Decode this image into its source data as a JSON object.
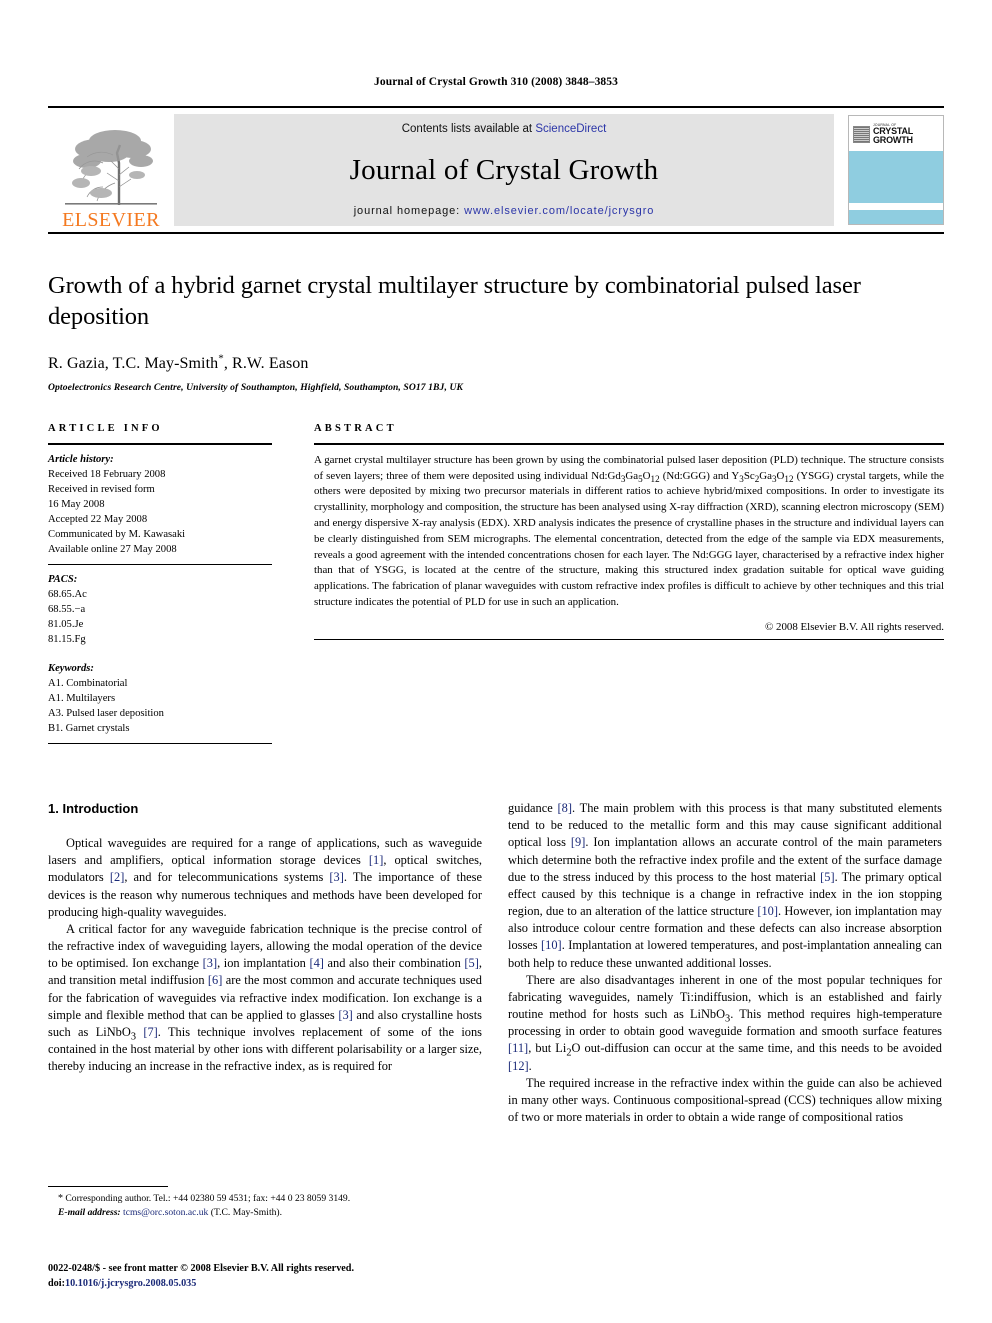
{
  "running_head": "Journal of Crystal Growth 310 (2008) 3848–3853",
  "masthead": {
    "publisher_name": "ELSEVIER",
    "contents_prefix": "Contents lists available at ",
    "contents_link": "ScienceDirect",
    "journal_title": "Journal of Crystal Growth",
    "homepage_prefix": "journal homepage: ",
    "homepage_url": "www.elsevier.com/locate/jcrysgro",
    "cover": {
      "pre_label": "JOURNAL OF",
      "line1": "CRYSTAL",
      "line2": "GROWTH",
      "accent_color": "#8fcde0"
    },
    "banner_bg": "#e3e3e3",
    "link_color": "#2b35a8",
    "elsevier_orange": "#F47920"
  },
  "article": {
    "title": "Growth of a hybrid garnet crystal multilayer structure by combinatorial pulsed laser deposition",
    "authors_before": "R. Gazia, T.C. May-Smith",
    "authors_star": "*",
    "authors_after": ", R.W. Eason",
    "affiliation": "Optoelectronics Research Centre, University of Southampton, Highfield, Southampton, SO17 1BJ, UK"
  },
  "article_info": {
    "heading": "ARTICLE INFO",
    "history_label": "Article history:",
    "history": [
      "Received 18 February 2008",
      "Received in revised form",
      "16 May 2008",
      "Accepted 22 May 2008",
      "Communicated by M. Kawasaki",
      "Available online 27 May 2008"
    ],
    "pacs_label": "PACS:",
    "pacs": [
      "68.65.Ac",
      "68.55.−a",
      "81.05.Je",
      "81.15.Fg"
    ],
    "keywords_label": "Keywords:",
    "keywords": [
      "A1. Combinatorial",
      "A1. Multilayers",
      "A3. Pulsed laser deposition",
      "B1. Garnet crystals"
    ]
  },
  "abstract": {
    "heading": "ABSTRACT",
    "p1_a": "A garnet crystal multilayer structure has been grown by using the combinatorial pulsed laser deposition (PLD) technique. The structure consists of seven layers; three of them were deposited using individual Nd:Gd",
    "f1_s1": "3",
    "f1_b1": "Ga",
    "f1_s2": "5",
    "f1_b2": "O",
    "f1_s3": "12",
    "p1_b": " (Nd:GGG) and Y",
    "f2_s1": "3",
    "f2_b1": "Sc",
    "f2_s2": "2",
    "f2_b2": "Ga",
    "f2_s3": "3",
    "f2_b3": "O",
    "f2_s4": "12",
    "p1_c": " (YSGG) crystal targets, while the others were deposited by mixing two precursor materials in different ratios to achieve hybrid/mixed compositions. In order to investigate its crystallinity, morphology and composition, the structure has been analysed using X-ray diffraction (XRD), scanning electron microscopy (SEM) and energy dispersive X-ray analysis (EDX). XRD analysis indicates the presence of crystalline phases in the structure and individual layers can be clearly distinguished from SEM micrographs. The elemental concentration, detected from the edge of the sample via EDX measurements, reveals a good agreement with the intended concentrations chosen for each layer. The Nd:GGG layer, characterised by a refractive index higher than that of YSGG, is located at the centre of the structure, making this structured index gradation suitable for optical wave guiding applications. The fabrication of planar waveguides with custom refractive index profiles is difficult to achieve by other techniques and this trial structure indicates the potential of PLD for use in such an application.",
    "copyright": "© 2008 Elsevier B.V. All rights reserved."
  },
  "body": {
    "section_title": "1. Introduction",
    "left": {
      "p1_a": "Optical waveguides are required for a range of applications, such as waveguide lasers and amplifiers, optical information storage devices ",
      "p1_r1": "[1]",
      "p1_b": ", optical switches, modulators ",
      "p1_r2": "[2]",
      "p1_c": ", and for telecommunications systems ",
      "p1_r3": "[3]",
      "p1_d": ". The importance of these devices is the reason why numerous techniques and methods have been developed for producing high-quality waveguides.",
      "p2_a": "A critical factor for any waveguide fabrication technique is the precise control of the refractive index of waveguiding layers, allowing the modal operation of the device to be optimised. Ion exchange ",
      "p2_r1": "[3]",
      "p2_b": ", ion implantation ",
      "p2_r2": "[4]",
      "p2_c": " and also their combination ",
      "p2_r3": "[5]",
      "p2_d": ", and transition metal indiffusion ",
      "p2_r4": "[6]",
      "p2_e": " are the most common and accurate techniques used for the fabrication of waveguides via refractive index modification. Ion exchange is a simple and flexible method that can be applied to glasses ",
      "p2_r5": "[3]",
      "p2_f": " and also crystalline hosts such as LiNbO",
      "p2_sub": "3",
      "p2_g": " ",
      "p2_r6": "[7]",
      "p2_h": ". This technique involves replacement of some of the ions contained in the host material by other ions with different polarisability or a larger size, thereby inducing an increase in the refractive index, as is required for"
    },
    "right": {
      "p1_a": "guidance ",
      "p1_r1": "[8]",
      "p1_b": ". The main problem with this process is that many substituted elements tend to be reduced to the metallic form and this may cause significant additional optical loss ",
      "p1_r2": "[9]",
      "p1_c": ". Ion implantation allows an accurate control of the main parameters which determine both the refractive index profile and the extent of the surface damage due to the stress induced by this process to the host material ",
      "p1_r3": "[5]",
      "p1_d": ". The primary optical effect caused by this technique is a change in refractive index in the ion stopping region, due to an alteration of the lattice structure ",
      "p1_r4": "[10]",
      "p1_e": ". However, ion implantation may also introduce colour centre formation and these defects can also increase absorption losses ",
      "p1_r5": "[10]",
      "p1_f": ". Implantation at lowered temperatures, and post-implantation annealing can both help to reduce these unwanted additional losses.",
      "p2_a": "There are also disadvantages inherent in one of the most popular techniques for fabricating waveguides, namely Ti:indiffusion, which is an established and fairly routine method for hosts such as LiNbO",
      "p2_sub1": "3",
      "p2_b": ". This method requires high-temperature processing in order to obtain good waveguide formation and smooth surface features ",
      "p2_r1": "[11]",
      "p2_c": ", but Li",
      "p2_sub2": "2",
      "p2_d": "O out-diffusion can occur at the same time, and this needs to be avoided ",
      "p2_r2": "[12]",
      "p2_e": ".",
      "p3": "The required increase in the refractive index within the guide can also be achieved in many other ways. Continuous compositional-spread (CCS) techniques allow mixing of two or more materials in order to obtain a wide range of compositional ratios"
    }
  },
  "footnote": {
    "star": "*",
    "corresponding": " Corresponding author. Tel.: +44 02380 59 4531; fax: +44 0 23 8059 3149.",
    "email_label": "E-mail address:",
    "email": "tcms@orc.soton.ac.uk",
    "email_owner": " (T.C. May-Smith)."
  },
  "footer": {
    "issn_line": "0022-0248/$ - see front matter © 2008 Elsevier B.V. All rights reserved.",
    "doi_label": "doi:",
    "doi": "10.1016/j.jcrysgro.2008.05.035"
  }
}
